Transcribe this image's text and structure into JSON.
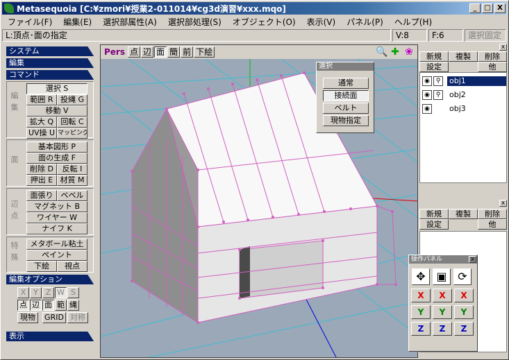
{
  "window": {
    "title": "Metasequoia [C:¥zmori¥授業2-011014¥cg3d演習¥xxx.mqo]",
    "min": "_",
    "max": "□",
    "close": "X"
  },
  "menu": [
    "ファイル(F)",
    "編集(E)",
    "選択部属性(A)",
    "選択部処理(S)",
    "オブジェクト(O)",
    "表示(V)",
    "パネル(P)",
    "ヘルプ(H)"
  ],
  "status": {
    "mode": "L:頂点･面の指定",
    "vertex": "V:8",
    "face": "F:6",
    "fix": "選択固定"
  },
  "left": {
    "system": "システム",
    "edit": "編集",
    "command": "コマンド",
    "group1_label": "編集",
    "group1": [
      "選択 S",
      "範囲 R",
      "投縄 G",
      "移動 V",
      "拡大 Q",
      "回転 C",
      "UV操 U",
      "マッピング"
    ],
    "group2_label": "面",
    "group2": [
      "基本図形 P",
      "面の生成 F",
      "削除 D",
      "反転 I",
      "押出 E",
      "材質 M"
    ],
    "group3_label": "辺点",
    "group3": [
      "面張り",
      "ベベル",
      "マグネット B",
      "ワイヤー W",
      "ナイフ K"
    ],
    "group4_label": "特殊",
    "group4": [
      "メタボール粘土",
      "ペイント",
      "下絵",
      "視点"
    ],
    "editopt": "編集オプション",
    "opt_row1": [
      "X",
      "Y",
      "Z",
      "W",
      "S"
    ],
    "opt_row2": [
      "点",
      "辺",
      "面",
      "範",
      "縄"
    ],
    "opt_row3": [
      "現物",
      "GRID",
      "対称"
    ],
    "display": "表示"
  },
  "viewport": {
    "label": "Pers",
    "buttons": [
      "点",
      "辺",
      "面",
      "簡",
      "前",
      "下絵"
    ]
  },
  "select_popup": {
    "caption": "選択",
    "buttons": [
      "通常",
      "接続面",
      "ベルト",
      "現物指定"
    ]
  },
  "objpanel": {
    "new": "新規",
    "dup": "複製",
    "del": "削除",
    "set": "設定",
    "other": "他",
    "objects": [
      "obj1",
      "obj2",
      "obj3"
    ]
  },
  "matpanel": {
    "new": "新規",
    "dup": "複製",
    "del": "削除",
    "set": "設定",
    "other": "他"
  },
  "oppanel": {
    "caption": "操作パネル",
    "rows": [
      [
        "X",
        "X",
        "X"
      ],
      [
        "Y",
        "Y",
        "Y"
      ],
      [
        "Z",
        "Z",
        "Z"
      ]
    ],
    "colors": {
      "X": "#e00000",
      "Y": "#008000",
      "Z": "#0000c0"
    }
  }
}
